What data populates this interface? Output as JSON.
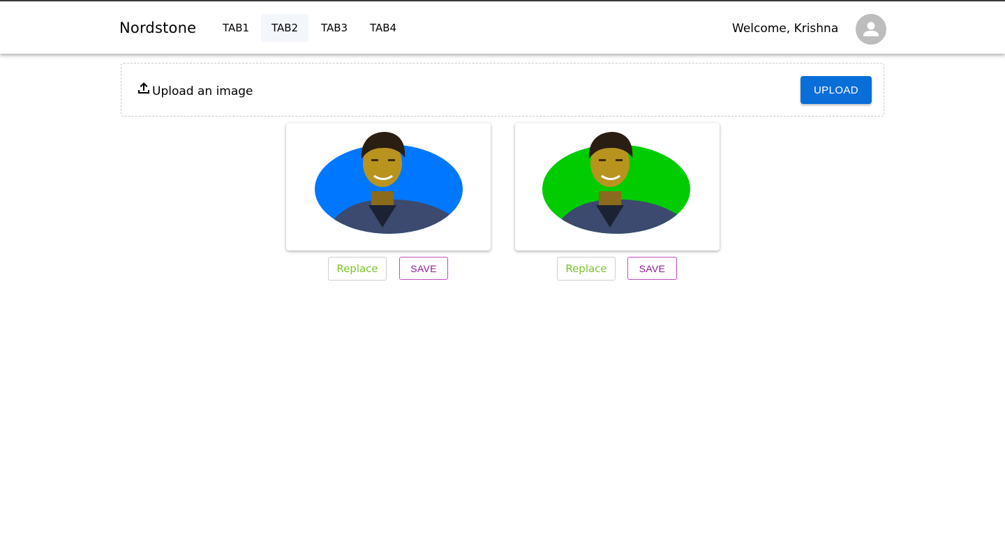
{
  "header": {
    "brand": "Nordstone",
    "tabs": [
      {
        "label": "TAB1",
        "active": false
      },
      {
        "label": "TAB2",
        "active": true
      },
      {
        "label": "TAB3",
        "active": false
      },
      {
        "label": "TAB4",
        "active": false
      }
    ],
    "welcome": "Welcome, Krishna",
    "avatar_icon": "account-circle-icon"
  },
  "upload": {
    "icon": "upload-icon",
    "label": "Upload an image",
    "button": "UPLOAD",
    "button_color": "#0a6ed8"
  },
  "cards": [
    {
      "background_color": "#0077ff",
      "replace_label": "Replace",
      "save_label": "SAVE"
    },
    {
      "background_color": "#00cc00",
      "replace_label": "Replace",
      "save_label": "SAVE"
    }
  ],
  "colors": {
    "replace_text": "#7cc32e",
    "save_text": "#8f1a9a",
    "save_border": "#c04cc4"
  }
}
